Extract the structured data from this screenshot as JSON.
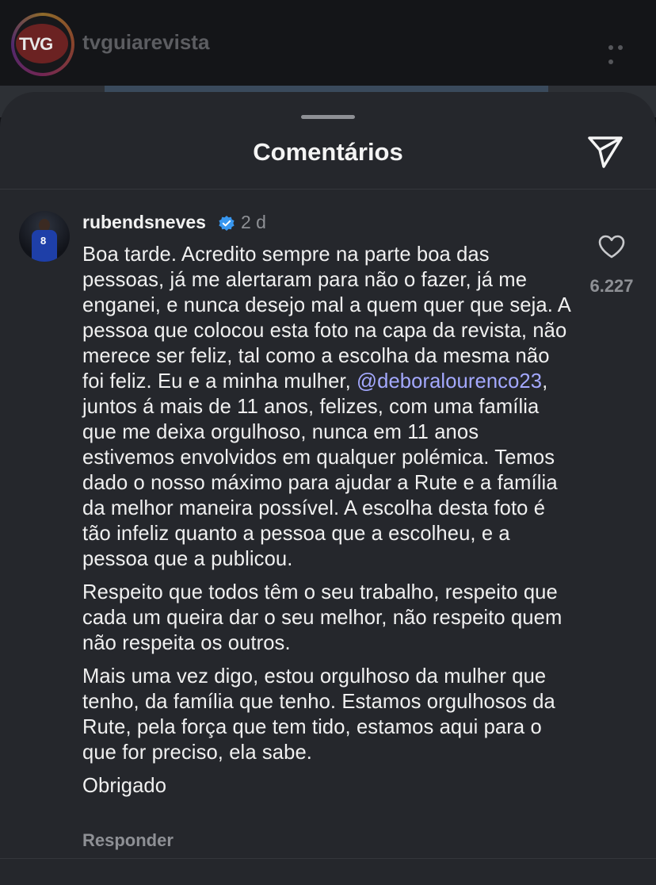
{
  "profile": {
    "logo_text": "TVG",
    "username": "tvguiarevista"
  },
  "sheet": {
    "title": "Comentários"
  },
  "comment": {
    "username": "rubendsneves",
    "verified": true,
    "time_ago": "2 d",
    "avatar_number": "8",
    "paragraph1_part1": "Boa tarde. Acredito sempre na parte boa das pessoas, já me alertaram para não o fazer, já me enganei, e nunca desejo mal a quem quer que seja. A pessoa que colocou esta foto na capa da revista, não merece ser feliz, tal como a escolha da mesma não foi feliz. Eu e a minha mulher, ",
    "mention": "@deboralourenco23",
    "paragraph1_part2": ", juntos á mais de 11 anos, felizes, com uma família que me deixa orgulhoso, nunca em 11 anos estivemos envolvidos em qualquer polémica. Temos dado o nosso máximo para ajudar a Rute e a família da melhor maneira possível. A escolha desta foto é tão infeliz quanto a pessoa que a escolheu, e a pessoa que a publicou.",
    "paragraph2": "Respeito que todos têm o seu trabalho, respeito que cada um queira dar o seu melhor, não respeito quem não respeita os outros.",
    "paragraph3": "Mais uma vez digo, estou orgulhoso da mulher que tenho, da família que tenho. Estamos orgulhosos da Rute, pela força que tem tido, estamos aqui para o que for preciso, ela sabe.",
    "paragraph4": "Obrigado",
    "like_count": "6.227",
    "reply_label": "Responder"
  },
  "icons": {
    "more": "more-horizontal-icon",
    "share": "paper-plane-icon",
    "heart": "heart-outline-icon",
    "verified": "verified-badge-icon"
  },
  "colors": {
    "sheet_background": "#25272c",
    "mention": "#a4a9ff",
    "verified_badge": "#3897f0",
    "secondary_text": "#8e9095"
  }
}
